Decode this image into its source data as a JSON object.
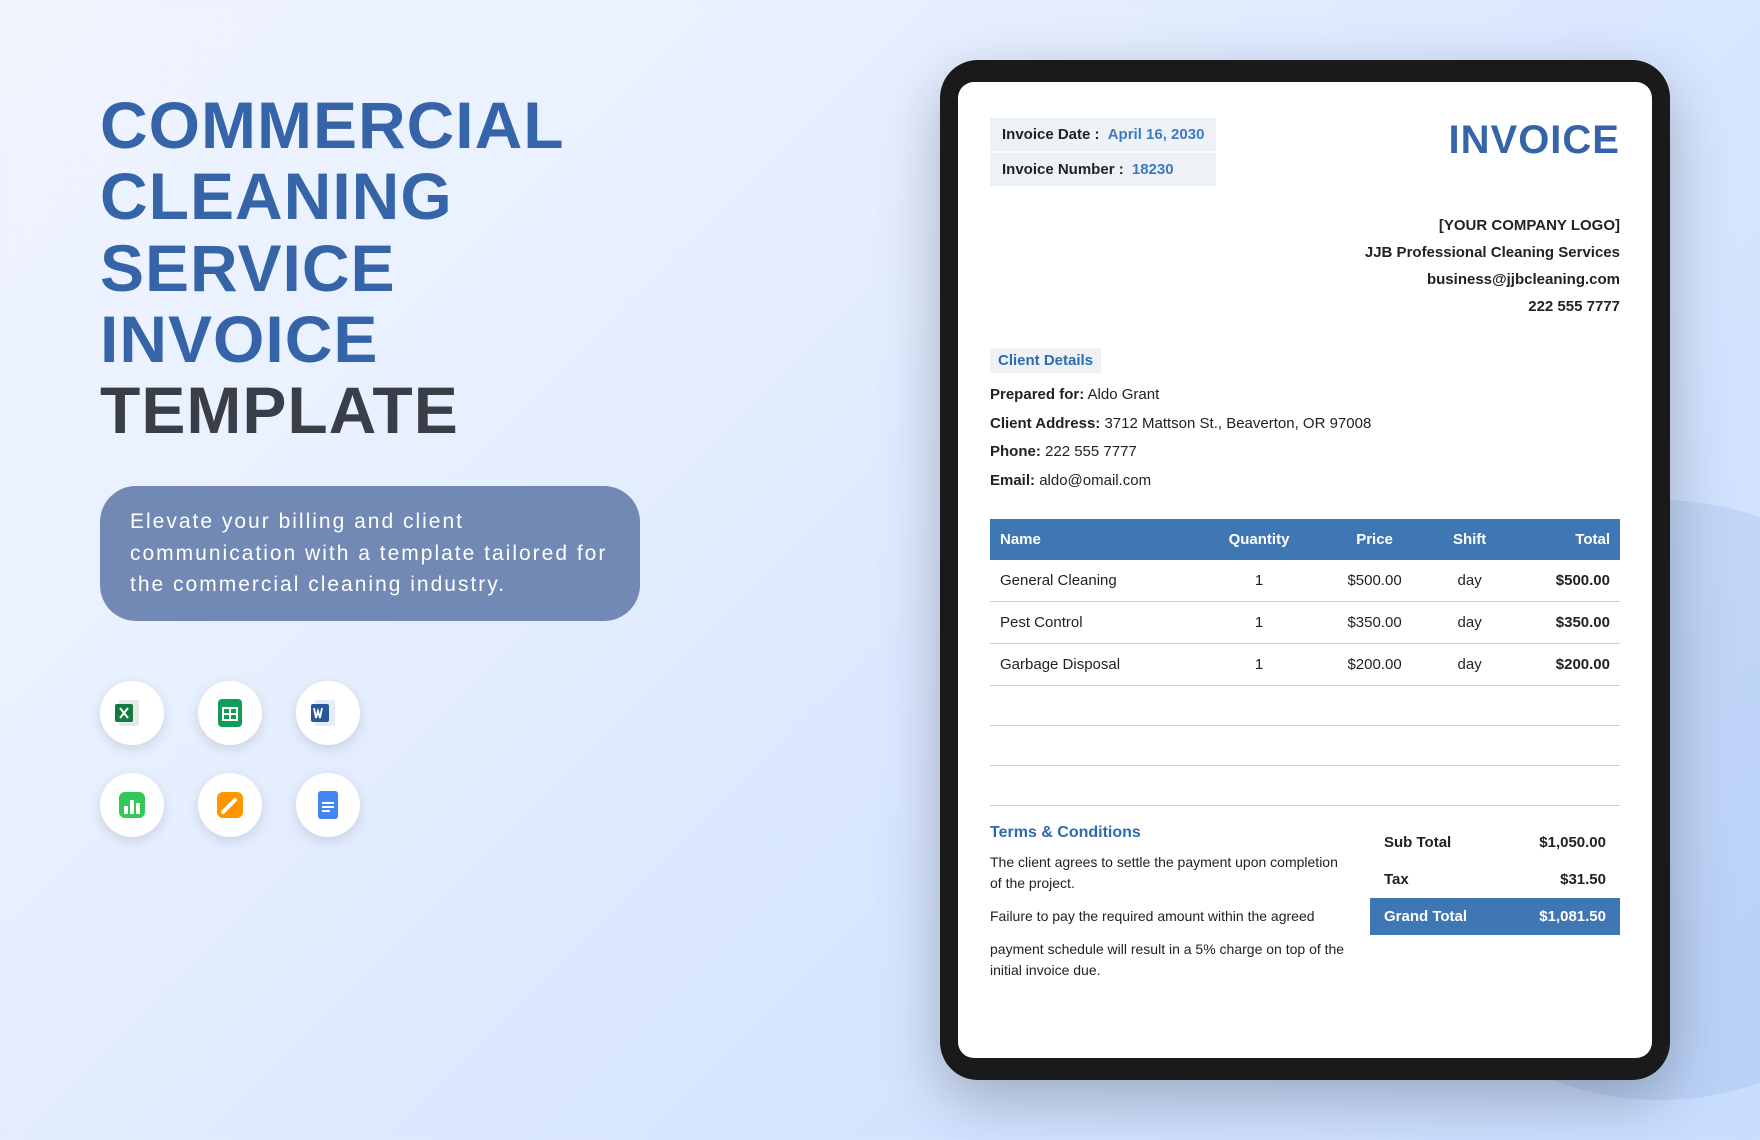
{
  "title": {
    "line1": "COMMERCIAL",
    "line2": "CLEANING",
    "line3": "SERVICE",
    "line4": "INVOICE",
    "line5": "TEMPLATE"
  },
  "tagline": "Elevate your billing and client communication with a template tailored for the commercial cleaning industry.",
  "icons": {
    "excel": "excel-icon",
    "sheets": "sheets-icon",
    "word": "word-icon",
    "numbers": "numbers-icon",
    "pages": "pages-icon",
    "docs": "docs-icon"
  },
  "invoice": {
    "label": "INVOICE",
    "date_label": "Invoice Date :",
    "date_value": "April 16, 2030",
    "number_label": "Invoice Number :",
    "number_value": "18230",
    "company": {
      "logo_placeholder": "[YOUR COMPANY LOGO]",
      "name": "JJB Professional Cleaning Services",
      "email": "business@jjbcleaning.com",
      "phone": "222 555 7777"
    },
    "client_section_title": "Client Details",
    "client": {
      "prepared_for_label": "Prepared for:",
      "prepared_for": "Aldo Grant",
      "address_label": "Client Address:",
      "address": "3712 Mattson St., Beaverton, OR 97008",
      "phone_label": "Phone:",
      "phone": "222 555 7777",
      "email_label": "Email:",
      "email": "aldo@omail.com"
    },
    "table": {
      "headers": {
        "name": "Name",
        "qty": "Quantity",
        "price": "Price",
        "shift": "Shift",
        "total": "Total"
      },
      "rows": [
        {
          "name": "General Cleaning",
          "qty": "1",
          "price": "$500.00",
          "shift": "day",
          "total": "$500.00"
        },
        {
          "name": "Pest Control",
          "qty": "1",
          "price": "$350.00",
          "shift": "day",
          "total": "$350.00"
        },
        {
          "name": "Garbage Disposal",
          "qty": "1",
          "price": "$200.00",
          "shift": "day",
          "total": "$200.00"
        }
      ]
    },
    "terms": {
      "title": "Terms & Conditions",
      "p1": "The client agrees to settle the payment upon completion of the project.",
      "p2": "Failure to pay the required amount within the agreed",
      "p3": "payment schedule will result in a 5% charge on top of the initial invoice due."
    },
    "totals": {
      "subtotal_label": "Sub Total",
      "subtotal": "$1,050.00",
      "tax_label": "Tax",
      "tax": "$31.50",
      "grand_label": "Grand Total",
      "grand": "$1,081.50"
    }
  }
}
